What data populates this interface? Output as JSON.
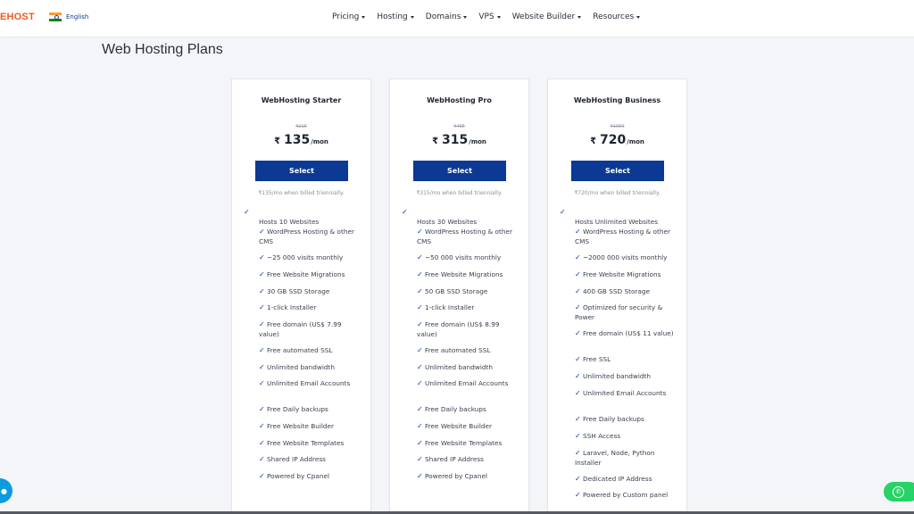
{
  "header": {
    "logo": "EHOST",
    "language": "English",
    "nav": [
      "Pricing",
      "Hosting",
      "Domains",
      "VPS",
      "Website Builder",
      "Resources"
    ]
  },
  "page_title": "Web Hosting Plans",
  "check_glyph": "✓",
  "plans": [
    {
      "name": "WebHosting Starter",
      "old_price": "₹215",
      "currency": "₹",
      "price": "135",
      "per": "/mon",
      "button": "Select",
      "billed": "₹135/mo when billed triennially.",
      "features": [
        "Hosts 10 Websites",
        "WordPress Hosting & other CMS",
        "~25 000 visits monthly",
        "Free Website Migrations",
        "30 GB SSD Storage",
        "1-click Installer",
        "Free domain (US$ 7.99 value)",
        "Free automated SSL",
        "Unlimited bandwidth",
        "Unlimited Email Accounts",
        "Free Daily backups",
        "Free Website Builder",
        "Free Website Templates",
        "Shared IP Address",
        "Powered by Cpanel"
      ]
    },
    {
      "name": "WebHosting Pro",
      "old_price": "₹495",
      "currency": "₹",
      "price": "315",
      "per": "/mon",
      "button": "Select",
      "billed": "₹315/mo when billed triennially.",
      "features": [
        "Hosts 30 Websites",
        "WordPress Hosting & other CMS",
        "~50 000 visits monthly",
        "Free Website Migrations",
        "50 GB SSD Storage",
        "1-click Installer",
        "Free domain (US$ 8.99 value)",
        "Free automated SSL",
        "Unlimited bandwidth",
        "Unlimited Email Accounts",
        "Free Daily backups",
        "Free Website Builder",
        "Free Website Templates",
        "Shared IP Address",
        "Powered by Cpanel"
      ]
    },
    {
      "name": "WebHosting Business",
      "old_price": "₹1050",
      "currency": "₹",
      "price": "720",
      "per": "/mon",
      "button": "Select",
      "billed": "₹720/mo when billed triennially.",
      "features": [
        "Hosts Unlimited Websites",
        "WordPress Hosting & other CMS",
        "~2000 000 visits monthly",
        "Free Website Migrations",
        "400 GB SSD Storage",
        "Optimized for security & Power",
        "Free domain (US$ 11 value)",
        "Free SSL",
        "Unlimited bandwidth",
        "Unlimited Email Accounts",
        "Free Daily backups",
        "SSH Access",
        "Laravel, Node, Python Installer",
        "Dedicated IP Address",
        "Powered by Custom panel"
      ]
    }
  ],
  "colors": {
    "brand_blue": "#0b3994",
    "logo_orange": "#f05a1a",
    "whatsapp_green": "#25d366",
    "chat_blue": "#0b9bde"
  }
}
